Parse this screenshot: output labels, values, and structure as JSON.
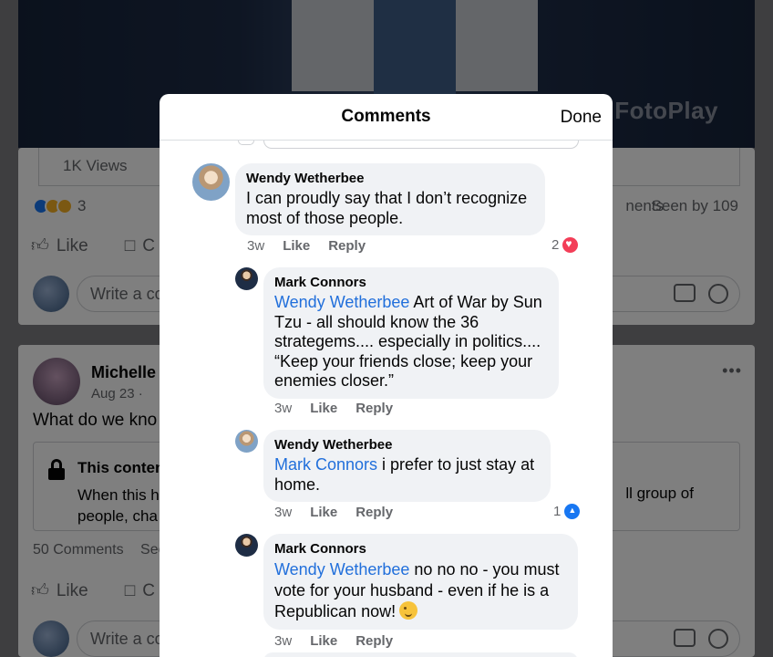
{
  "background": {
    "watermark": "FotoPlay",
    "card1": {
      "views": "1K Views",
      "reaction_count": "3",
      "comments_partial": "nents",
      "seen_by": "Seen by 109",
      "like_label": "Like",
      "comment_partial": "C",
      "write_placeholder": "Write a co"
    },
    "card2": {
      "author": "Michelle",
      "date": "Aug 23 ·",
      "text": "What do we kno",
      "more": "•••",
      "locked_title": "This conten",
      "locked_line1": "When this h",
      "locked_line2": "people, cha",
      "locked_right": "ll group of",
      "comments": "50 Comments",
      "seen_partial": "See",
      "like_label": "Like",
      "comment_partial": "C",
      "write_placeholder": "Write a co"
    }
  },
  "modal": {
    "title": "Comments",
    "done_label": "Done",
    "comments": [
      {
        "author": "Wendy Wetherbee",
        "text": "I can proudly say that I don’t recognize most of those people.",
        "time": "3w",
        "like": "Like",
        "reply": "Reply",
        "reaction_count": "2",
        "reaction": "heart"
      },
      {
        "author": "Mark Connors",
        "mention": "Wendy Wetherbee",
        "text": " Art of War by Sun Tzu - all should know the 36 strategems.... especially in politics.... “Keep your friends close; keep your enemies closer.”",
        "time": "3w",
        "like": "Like",
        "reply": "Reply"
      },
      {
        "author": "Wendy Wetherbee",
        "mention": "Mark Connors",
        "text": " i prefer to just stay at home.",
        "time": "3w",
        "like": "Like",
        "reply": "Reply",
        "reaction_count": "1",
        "reaction": "like"
      },
      {
        "author": "Mark Connors",
        "mention": "Wendy Wetherbee",
        "text": "  no no no - you must vote for your husband - even if he is a Republican now!",
        "emoji": "winking-face",
        "time": "3w",
        "like": "Like",
        "reply": "Reply"
      }
    ]
  }
}
